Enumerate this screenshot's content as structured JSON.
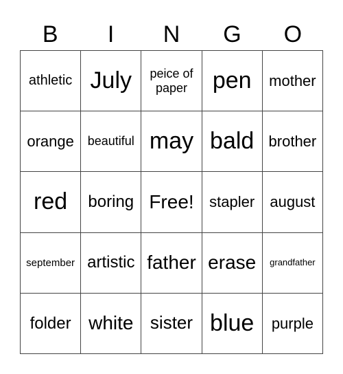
{
  "header": [
    "B",
    "I",
    "N",
    "G",
    "O"
  ],
  "cells": [
    {
      "text": "athletic",
      "size": "s20"
    },
    {
      "text": "July",
      "size": "s34"
    },
    {
      "text": "peice of paper",
      "size": "s18"
    },
    {
      "text": "pen",
      "size": "s34"
    },
    {
      "text": "mother",
      "size": "s22"
    },
    {
      "text": "orange",
      "size": "s22"
    },
    {
      "text": "beautiful",
      "size": "s18"
    },
    {
      "text": "may",
      "size": "s34"
    },
    {
      "text": "bald",
      "size": "s34"
    },
    {
      "text": "brother",
      "size": "s22"
    },
    {
      "text": "red",
      "size": "s34"
    },
    {
      "text": "boring",
      "size": "s24"
    },
    {
      "text": "Free!",
      "size": "s28"
    },
    {
      "text": "stapler",
      "size": "s22"
    },
    {
      "text": "august",
      "size": "s22"
    },
    {
      "text": "september",
      "size": "s15"
    },
    {
      "text": "artistic",
      "size": "s24"
    },
    {
      "text": "father",
      "size": "s28"
    },
    {
      "text": "erase",
      "size": "s28"
    },
    {
      "text": "grandfather",
      "size": "s13"
    },
    {
      "text": "folder",
      "size": "s24"
    },
    {
      "text": "white",
      "size": "s28"
    },
    {
      "text": "sister",
      "size": "s26"
    },
    {
      "text": "blue",
      "size": "s34"
    },
    {
      "text": "purple",
      "size": "s22"
    }
  ]
}
